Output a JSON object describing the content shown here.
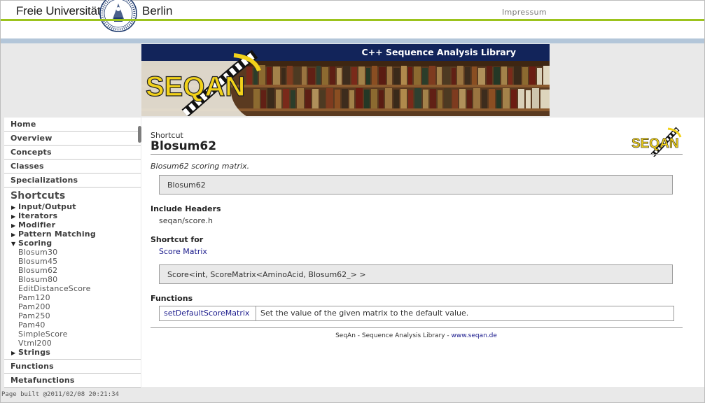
{
  "header": {
    "university_name": "Freie Universität",
    "university_city": "Berlin",
    "impressum_label": "Impressum"
  },
  "banner": {
    "title": "C++ Sequence Analysis Library",
    "logo_text": "SEQAN"
  },
  "sidebar": {
    "top_items": [
      "Home",
      "Overview",
      "Concepts",
      "Classes",
      "Specializations"
    ],
    "section_title": "Shortcuts",
    "tree": [
      {
        "label": "Input/Output",
        "expanded": false
      },
      {
        "label": "Iterators",
        "expanded": false
      },
      {
        "label": "Modifier",
        "expanded": false
      },
      {
        "label": "Pattern Matching",
        "expanded": false
      },
      {
        "label": "Scoring",
        "expanded": true
      }
    ],
    "scoring_children": [
      "Blosum30",
      "Blosum45",
      "Blosum62",
      "Blosum80",
      "EditDistanceScore",
      "Pam120",
      "Pam200",
      "Pam250",
      "Pam40",
      "SimpleScore",
      "Vtml200"
    ],
    "tree_after": {
      "label": "Strings",
      "expanded": false
    },
    "bottom_items": [
      "Functions",
      "Metafunctions"
    ]
  },
  "main": {
    "kind": "Shortcut",
    "title": "Blosum62",
    "description": "Blosum62 scoring matrix.",
    "signature": "Blosum62",
    "include_headers_label": "Include Headers",
    "include_header": "seqan/score.h",
    "shortcut_for_label": "Shortcut for",
    "shortcut_for_link": "Score Matrix",
    "shortcut_for_code": "Score<int, ScoreMatrix<AminoAcid, Blosum62_> >",
    "functions_label": "Functions",
    "functions": [
      {
        "name": "setDefaultScoreMatrix",
        "description": "Set the value of the given matrix to the default value."
      }
    ],
    "logo_text": "SEQAN"
  },
  "footer": {
    "text": "SeqAn - Sequence Analysis Library - ",
    "link": "www.seqan.de"
  },
  "page_built": "Page built @2011/02/08 20:21:34",
  "colors": {
    "green_accent": "#9cc31d",
    "banner_navy": "#12245a",
    "link_blue": "#1a1a8c",
    "logo_yellow": "#f2d21a"
  }
}
